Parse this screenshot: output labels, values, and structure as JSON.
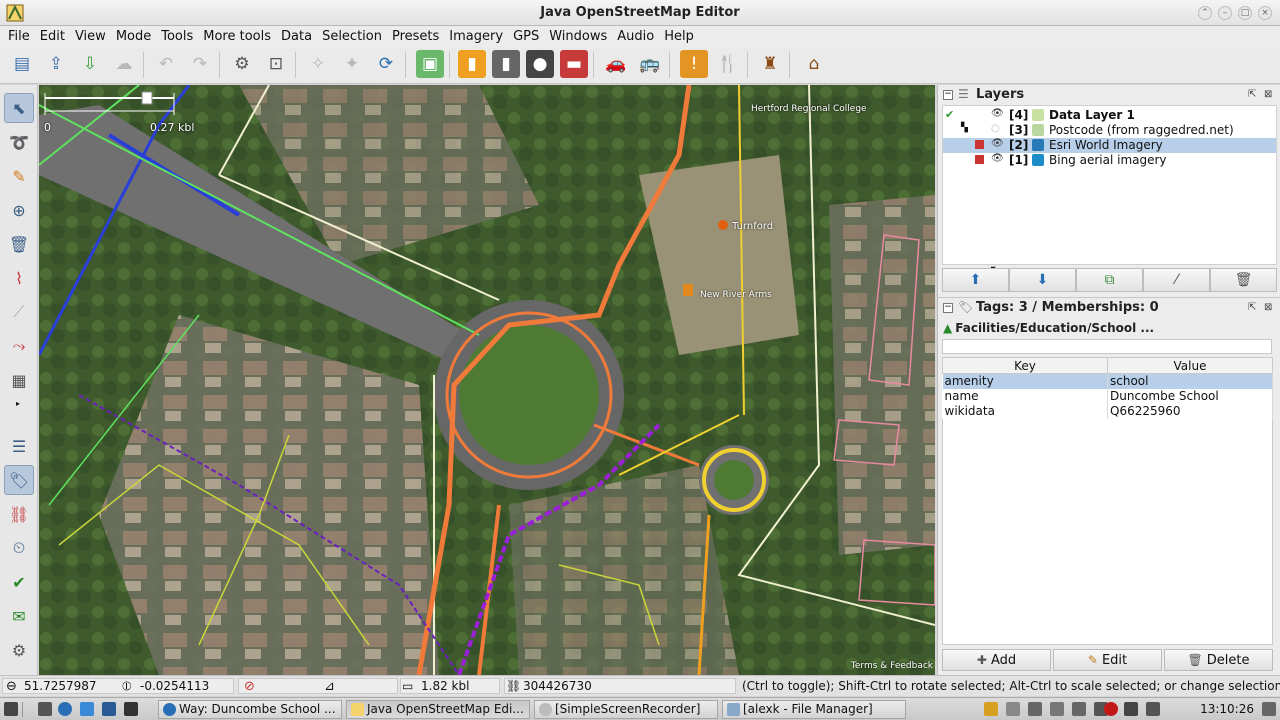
{
  "window": {
    "title": "Java OpenStreetMap Editor"
  },
  "menus": [
    "File",
    "Edit",
    "View",
    "Mode",
    "Tools",
    "More tools",
    "Data",
    "Selection",
    "Presets",
    "Imagery",
    "GPS",
    "Windows",
    "Audio",
    "Help"
  ],
  "map": {
    "scale_start": "0",
    "scale_end": "0.27 kbl",
    "labels": {
      "turnford": "Turnford",
      "new_river_arms": "New River Arms",
      "college": "Hertford Regional College"
    },
    "terms": "Terms & Feedback"
  },
  "layers_panel": {
    "title": "Layers",
    "layers": [
      {
        "num": "[4]",
        "name": "Data Layer 1",
        "bold": true
      },
      {
        "num": "[3]",
        "name": "Postcode (from raggedred.net)"
      },
      {
        "num": "[2]",
        "name": "Esri World Imagery"
      },
      {
        "num": "[1]",
        "name": "Bing aerial imagery"
      }
    ]
  },
  "tags_panel": {
    "title": "Tags: 3 / Memberships: 0",
    "preset": "Facilities/Education/School ...",
    "columns": {
      "key": "Key",
      "value": "Value"
    },
    "rows": [
      {
        "key": "amenity",
        "value": "school"
      },
      {
        "key": "name",
        "value": "Duncombe School"
      },
      {
        "key": "wikidata",
        "value": "Q66225960"
      }
    ],
    "buttons": {
      "add": "Add",
      "edit": "Edit",
      "delete": "Delete"
    }
  },
  "status": {
    "lat": "51.7257987",
    "lon": "-0.0254113",
    "distance": "1.82 kbl",
    "id": "304426730",
    "help": "(Ctrl to toggle); Shift-Ctrl to rotate selected; Alt-Ctrl to scale selected; or change selection"
  },
  "taskbar": {
    "tasks": [
      "Way: Duncombe School ...",
      "Java OpenStreetMap Edi...",
      "[SimpleScreenRecorder]",
      "[alexk - File Manager]"
    ],
    "clock": "13:10:26"
  }
}
